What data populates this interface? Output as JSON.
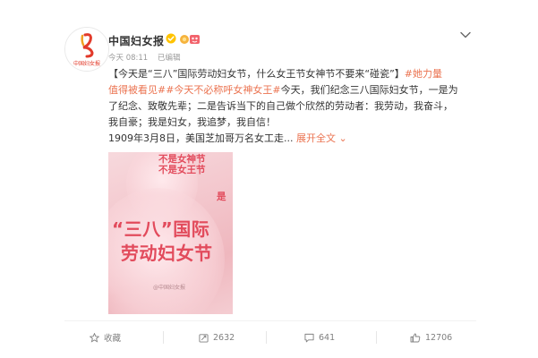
{
  "post": {
    "author": "中国妇女报",
    "logo_text": "中国妇女报",
    "time": "今天 08:11",
    "edited": "已编辑",
    "text_lines": [
      {
        "segments": [
          {
            "text": "【今天是“三八”国际劳动妇女节，什么女王节女神节不要来“碰瓷”】",
            "type": "text"
          },
          {
            "text": "#她力量",
            "type": "tag"
          }
        ]
      },
      {
        "segments": [
          {
            "text": "值得被看见#",
            "type": "tag"
          },
          {
            "text": "#今天不必称呼女神女王#",
            "type": "tag"
          },
          {
            "text": "今天，我们纪念三八国际妇女节，一是为",
            "type": "text"
          }
        ]
      },
      {
        "segments": [
          {
            "text": "了纪念、致敬先辈；二是告诉当下的自己做个欣然的劳动者：我劳动，我奋斗，",
            "type": "text"
          }
        ]
      },
      {
        "segments": [
          {
            "text": "我自豪；我是妇女，我追梦，我自信！",
            "type": "text"
          }
        ]
      },
      {
        "segments": [
          {
            "text": "1909年3月8日，美国芝加哥万名女工走...",
            "type": "text"
          },
          {
            "text": " 展开全文",
            "type": "link"
          },
          {
            "text": " ⌄",
            "type": "link"
          }
        ]
      }
    ]
  },
  "poster": {
    "line1": "不是女神节",
    "line2": "不是女王节",
    "line3": "是",
    "big1": "“三八”国际",
    "big2": "劳动妇女节",
    "watermark": "@中国妇女报"
  },
  "actions": {
    "favorite": "收藏",
    "repost": "2632",
    "comment": "641",
    "like": "12706"
  },
  "colors": {
    "accent": "#eb7350",
    "verified": "#ffc300",
    "poster_text": "#e24b5c"
  },
  "icons": [
    "verified-icon",
    "badge-icon",
    "chevron-down-icon",
    "star-icon",
    "repost-icon",
    "comment-icon",
    "like-icon"
  ]
}
